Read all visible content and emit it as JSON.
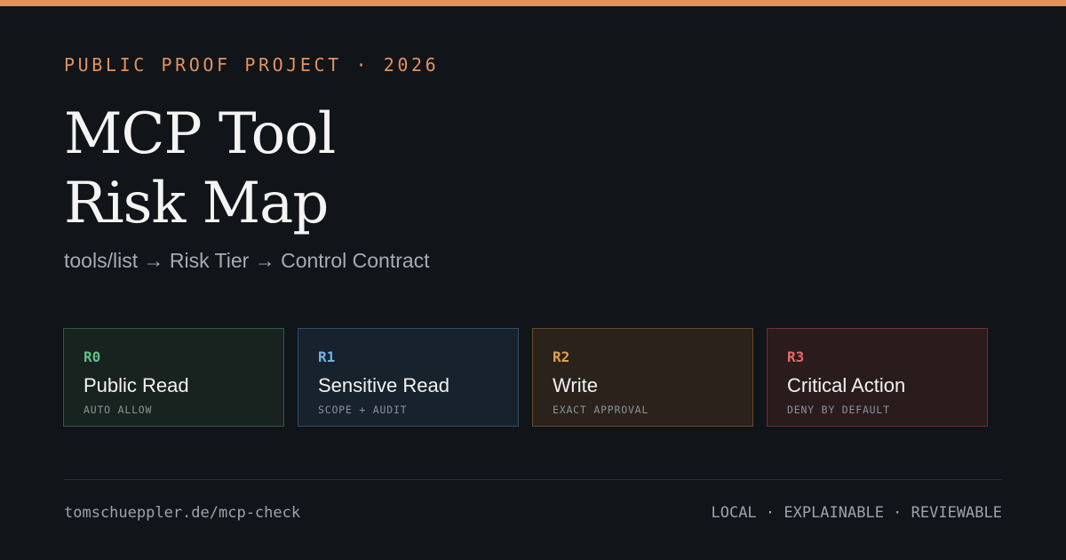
{
  "eyebrow": "PUBLIC PROOF PROJECT · 2026",
  "title": {
    "line1": "MCP Tool",
    "line2": "Risk Map"
  },
  "subtitle": "tools/list → Risk Tier → Control Contract",
  "tiers": [
    {
      "code": "R0",
      "name": "Public Read",
      "policy": "AUTO ALLOW",
      "accent": "#5fbf88",
      "border": "#2c5b43",
      "bg": "#18231f"
    },
    {
      "code": "R1",
      "name": "Sensitive Read",
      "policy": "SCOPE + AUDIT",
      "accent": "#6fb3e6",
      "border": "#2f4f6e",
      "bg": "#18222d"
    },
    {
      "code": "R2",
      "name": "Write",
      "policy": "EXACT APPROVAL",
      "accent": "#e0a050",
      "border": "#6a4a26",
      "bg": "#2a221b"
    },
    {
      "code": "R3",
      "name": "Critical Action",
      "policy": "DENY BY DEFAULT",
      "accent": "#e46b63",
      "border": "#6e302e",
      "bg": "#2a1c1d"
    }
  ],
  "footer": {
    "url": "tomschueppler.de/mcp-check",
    "tags": "LOCAL · EXPLAINABLE · REVIEWABLE"
  },
  "colors": {
    "background": "#111418",
    "accent": "#e0935f"
  }
}
